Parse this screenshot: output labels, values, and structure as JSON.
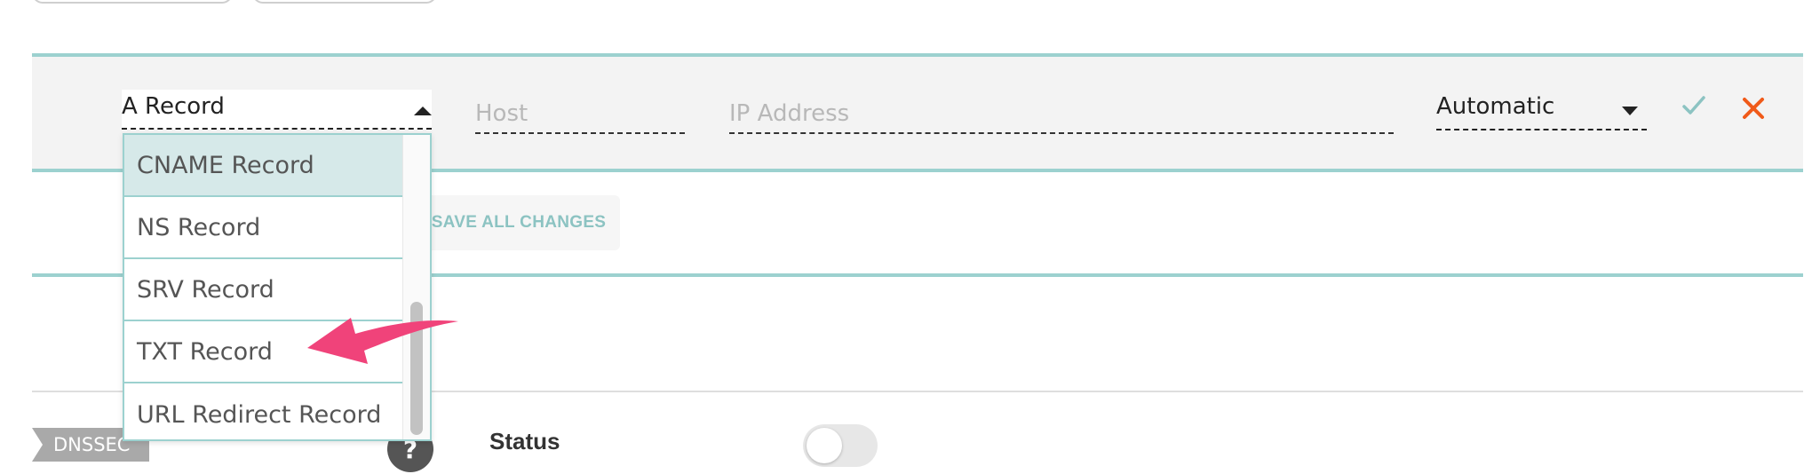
{
  "record_type_select": {
    "value": "A Record",
    "options": [
      "CNAME Record",
      "NS Record",
      "SRV Record",
      "TXT Record",
      "URL Redirect Record"
    ],
    "highlighted": "CNAME Record"
  },
  "fields": {
    "host_placeholder": "Host",
    "ip_placeholder": "IP Address"
  },
  "ttl_select": {
    "value": "Automatic"
  },
  "actions": {
    "save_all": "SAVE ALL CHANGES"
  },
  "dnssec": {
    "tag": "DNSSEC",
    "help": "?",
    "status_label": "Status"
  },
  "colors": {
    "accent": "#9cd1cf",
    "check": "#8cc3c2",
    "close": "#f05a19",
    "annotation_arrow": "#f0437a"
  },
  "icons": [
    "caret-up-icon",
    "caret-down-icon",
    "check-icon",
    "close-icon",
    "help-icon",
    "annotation-arrow"
  ]
}
